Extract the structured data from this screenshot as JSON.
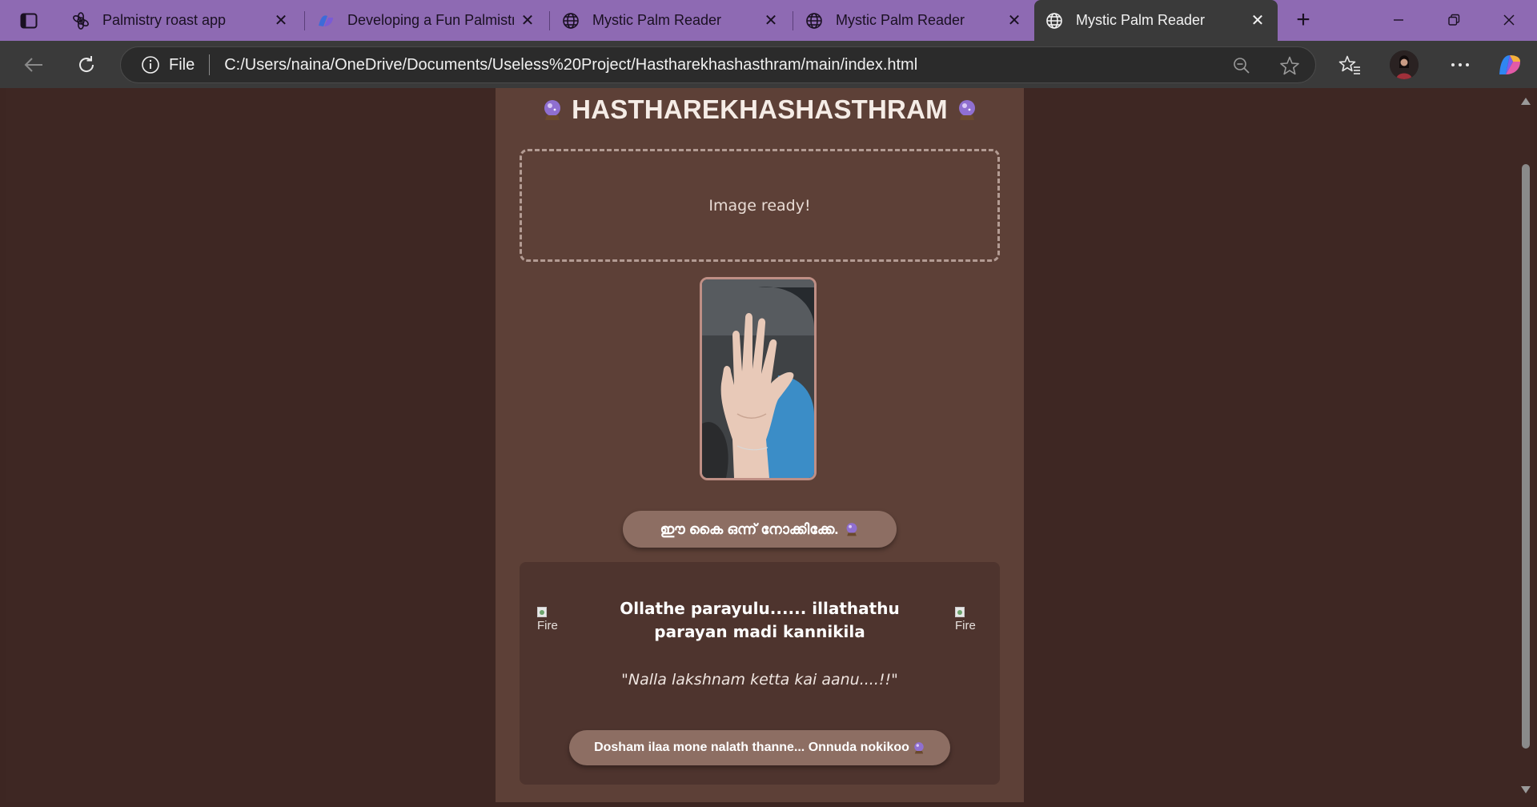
{
  "browser": {
    "tabs": [
      {
        "title": "Palmistry roast app",
        "favicon": "chatgpt-icon",
        "active": false
      },
      {
        "title": "Developing a Fun Palmistry",
        "favicon": "copilot-icon",
        "active": false
      },
      {
        "title": "Mystic Palm Reader",
        "favicon": "globe-icon",
        "active": false
      },
      {
        "title": "Mystic Palm Reader",
        "favicon": "globe-icon",
        "active": false
      },
      {
        "title": "Mystic Palm Reader",
        "favicon": "globe-icon",
        "active": true
      }
    ],
    "address": {
      "scheme_label": "File",
      "url": "C:/Users/naina/OneDrive/Documents/Useless%20Project/Hastharekhashasthram/main/index.html"
    },
    "colors": {
      "tabstrip": "#8e6ab3",
      "toolbar": "#3a3a3a"
    }
  },
  "page": {
    "heading": "HASTHAREKHASHASTHRAM",
    "upload_status": "Image ready!",
    "analyze_button": "ഈ കൈ ഒന്ന് നോക്കിക്കേ.",
    "result": {
      "verdict": "Ollathe parayulu...... illathathu parayan madi kannikila",
      "quote": "\"Nalla lakshnam ketta kai aanu....!!\"",
      "gif_alt": "Fire",
      "retry_button": "Dosham ilaa mone nalath thanne... Onnuda nokikoo"
    },
    "colors": {
      "background": "#3e2723",
      "card": "#5d4037",
      "result_panel": "#4e342e",
      "button": "#8d6e63",
      "dash_border": "#b39b93"
    }
  }
}
